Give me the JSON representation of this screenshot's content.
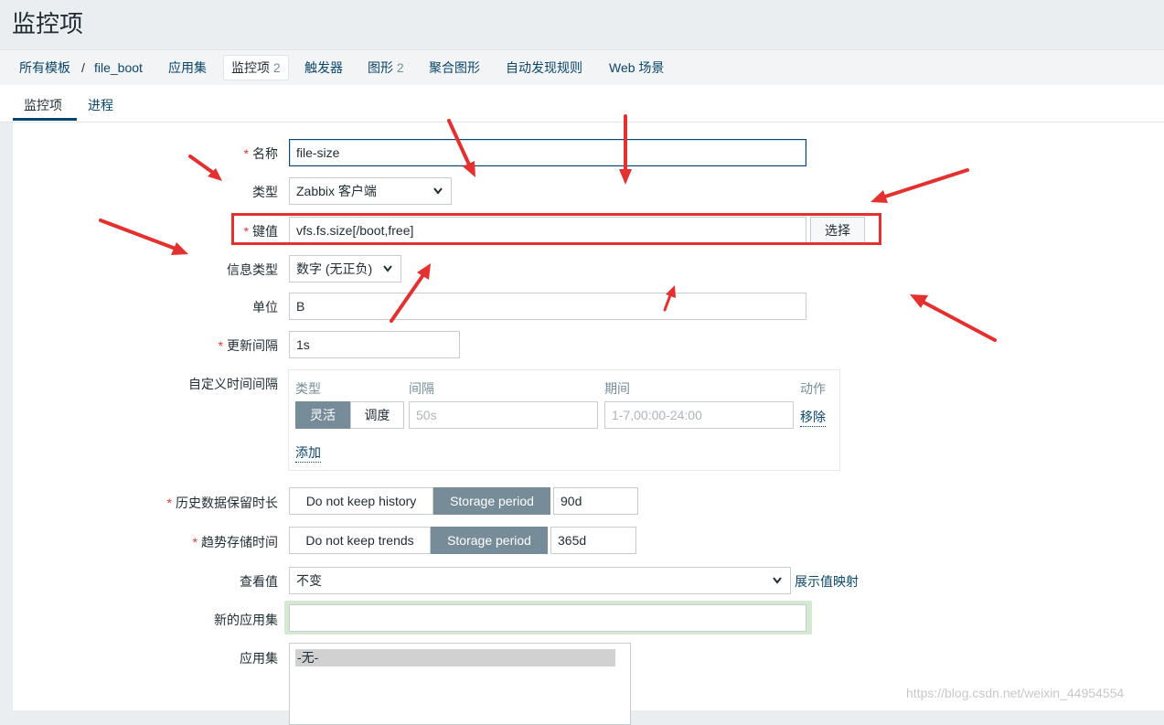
{
  "page": {
    "title": "监控项"
  },
  "nav": {
    "breadcrumb_root": "所有模板",
    "separator": "/",
    "breadcrumb_host": "file_boot",
    "applications": "应用集",
    "items": "监控项",
    "items_count": "2",
    "triggers": "触发器",
    "graphs": "图形",
    "graphs_count": "2",
    "screens": "聚合图形",
    "discovery": "自动发现规则",
    "web": "Web 场景"
  },
  "tabs": {
    "item": "监控项",
    "process": "进程"
  },
  "form": {
    "name_label": "名称",
    "name_value": "file-size",
    "type_label": "类型",
    "type_value": "Zabbix 客户端",
    "key_label": "键值",
    "key_value": "vfs.fs.size[/boot,free]",
    "key_select_btn": "选择",
    "info_type_label": "信息类型",
    "info_type_value": "数字 (无正负)",
    "units_label": "单位",
    "units_value": "B",
    "interval_label": "更新间隔",
    "interval_value": "1s",
    "custom_intervals": {
      "label": "自定义时间间隔",
      "col_type": "类型",
      "col_interval": "间隔",
      "col_period": "期间",
      "col_action": "动作",
      "flexible": "灵活",
      "scheduling": "调度",
      "interval_placeholder": "50s",
      "period_placeholder": "1-7,00:00-24:00",
      "remove": "移除",
      "add": "添加"
    },
    "history": {
      "label": "历史数据保留时长",
      "option_off": "Do not keep history",
      "option_on": "Storage period",
      "value": "90d"
    },
    "trends": {
      "label": "趋势存储时间",
      "option_off": "Do not keep trends",
      "option_on": "Storage period",
      "value": "365d"
    },
    "valuemap": {
      "label": "查看值",
      "value": "不变",
      "link": "展示值映射"
    },
    "new_application_label": "新的应用集",
    "new_application_value": "",
    "applications_label": "应用集",
    "applications_options": [
      "-无-"
    ]
  },
  "required_mark": "*",
  "watermark": "https://blog.csdn.net/weixin_44954554",
  "colors": {
    "link": "#0a466a",
    "required": "#e53030",
    "toggle_active": "#768d99",
    "annotation_red": "#e53030"
  }
}
